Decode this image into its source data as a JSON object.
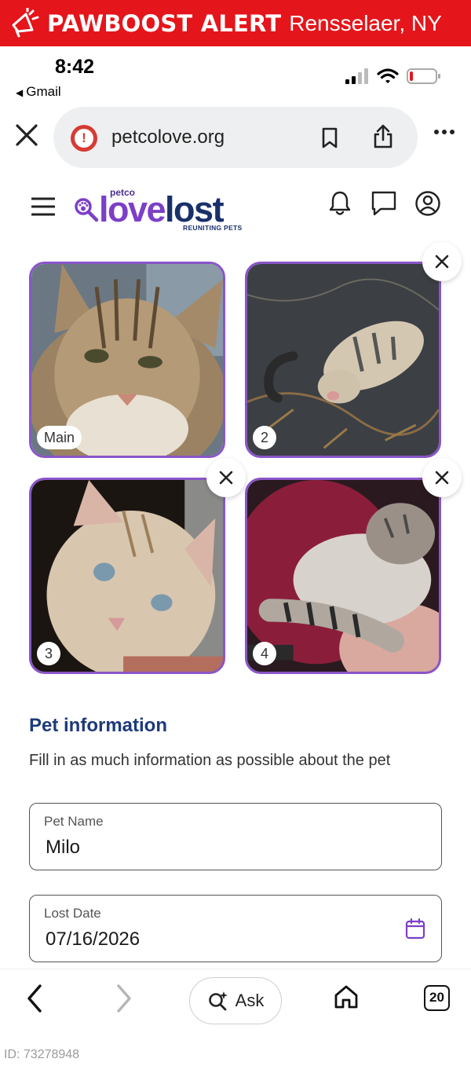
{
  "banner": {
    "title": "PAWBOOST ALERT",
    "location": "Rensselaer, NY",
    "background": "#e4151b"
  },
  "status_bar": {
    "time": "8:42",
    "back_app": "Gmail",
    "signal_bars": 2,
    "battery_level": 0.12
  },
  "browser": {
    "url": "petcolove.org",
    "tab_count": "20",
    "ask_label": "Ask",
    "security_icon": "warning-icon"
  },
  "site": {
    "brand_small": "petco",
    "brand_love": "love",
    "brand_lost": "lost",
    "tagline": "REUNITING PETS",
    "colors": {
      "love": "#7c3fc7",
      "lost": "#18306b",
      "photo_border": "#8a55c9"
    }
  },
  "photos": [
    {
      "label": "Main",
      "removable": false
    },
    {
      "label": "2",
      "removable": true
    },
    {
      "label": "3",
      "removable": true
    },
    {
      "label": "4",
      "removable": true
    }
  ],
  "pet_info": {
    "title": "Pet information",
    "subtitle": "Fill in as much information as possible about the pet",
    "fields": [
      {
        "label": "Pet Name",
        "value": "Milo"
      },
      {
        "label": "Lost Date",
        "value": "07/16/2026",
        "icon": "calendar-icon"
      }
    ]
  },
  "footer_id": "ID: 73278948"
}
